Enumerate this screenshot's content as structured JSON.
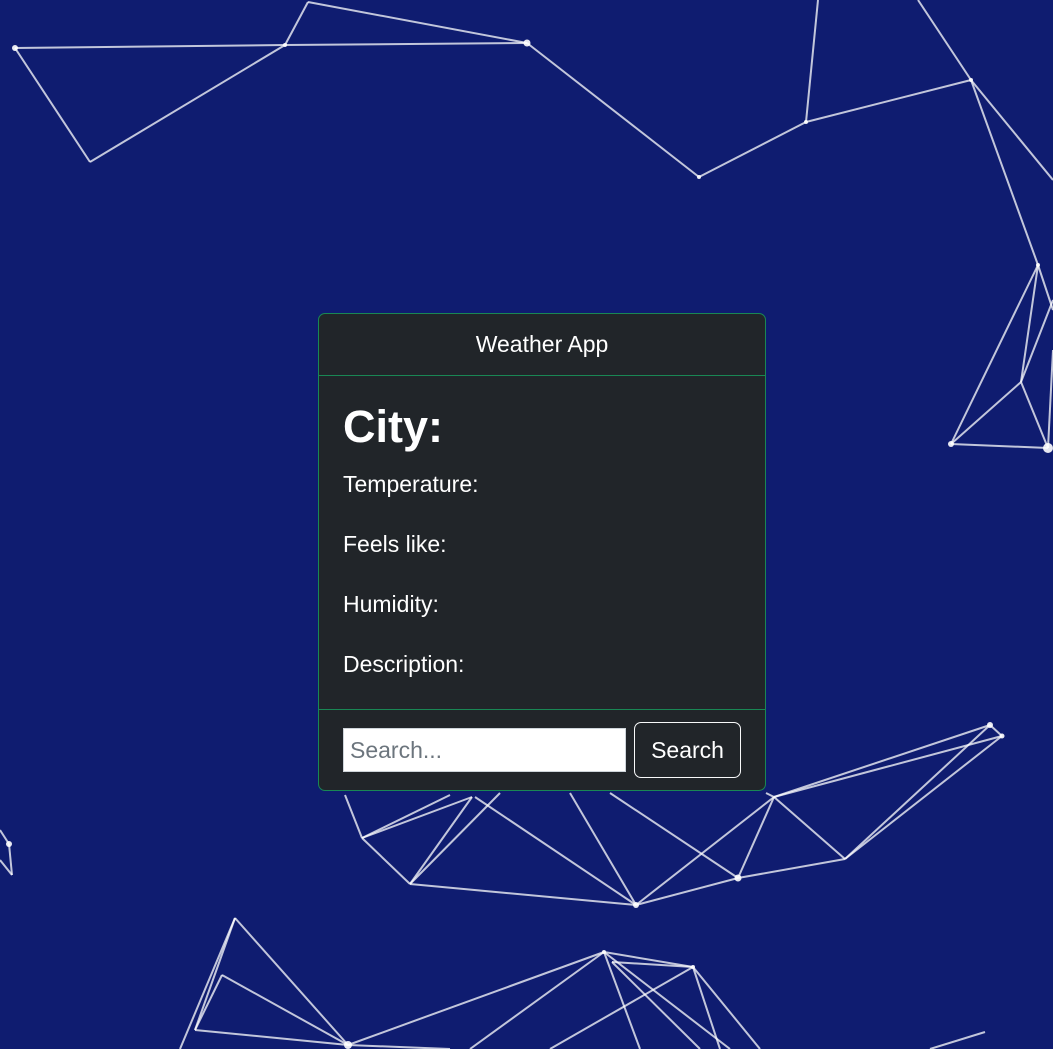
{
  "header": {
    "title": "Weather App"
  },
  "weather": {
    "city_label": "City:",
    "temperature_label": "Temperature:",
    "feels_like_label": "Feels like:",
    "humidity_label": "Humidity:",
    "description_label": "Description:"
  },
  "search": {
    "placeholder": "Search...",
    "value": "",
    "button_label": "Search"
  },
  "colors": {
    "background": "#0f1c70",
    "card": "#212529",
    "border": "#198754",
    "network_lines": "#ffffff"
  }
}
